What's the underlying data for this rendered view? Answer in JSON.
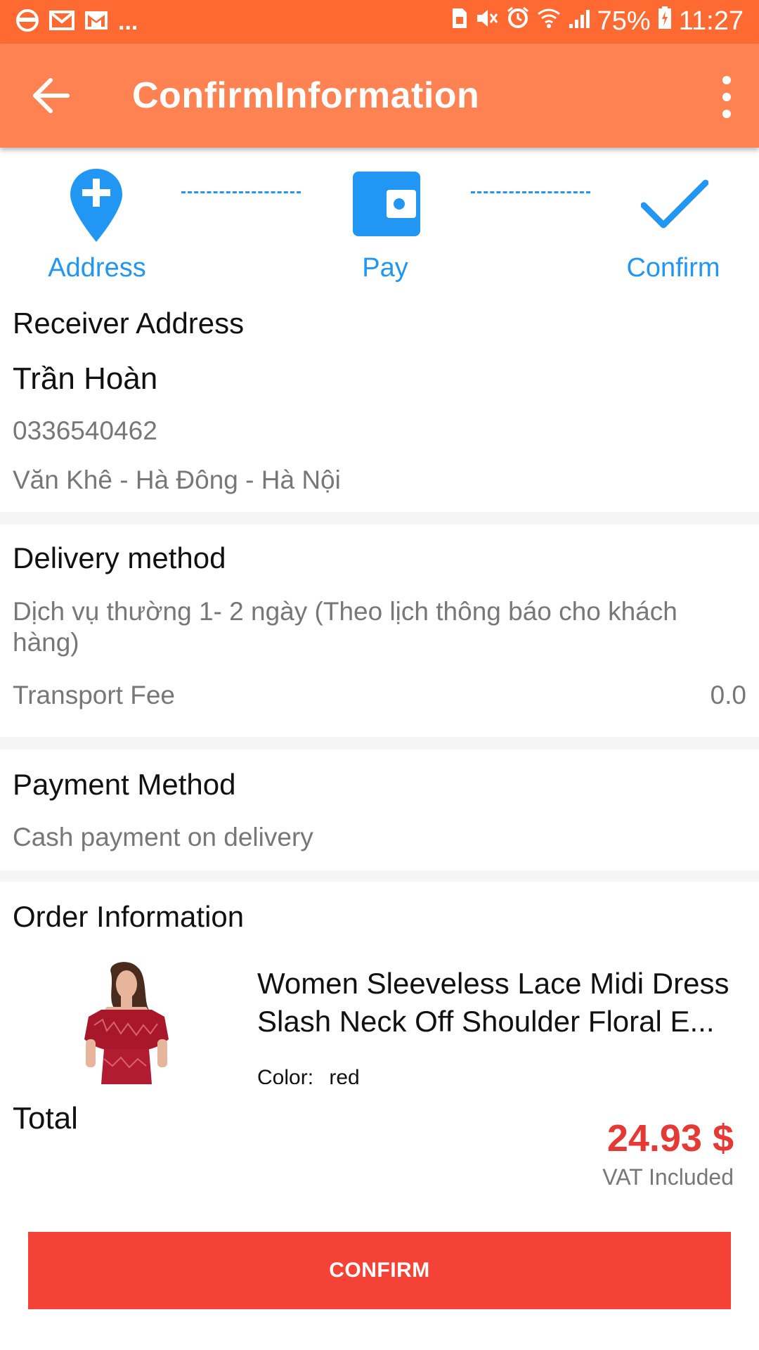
{
  "status_bar": {
    "battery": "75%",
    "time": "11:27",
    "more": "..."
  },
  "app_bar": {
    "title": "ConfirmInformation"
  },
  "steps": [
    {
      "label": "Address",
      "icon": "location-plus-icon"
    },
    {
      "label": "Pay",
      "icon": "wallet-icon"
    },
    {
      "label": "Confirm",
      "icon": "check-icon"
    }
  ],
  "receiver": {
    "heading": "Receiver Address",
    "name": "Trần Hoàn",
    "phone": "0336540462",
    "address": "Văn Khê - Hà Đông - Hà Nội"
  },
  "delivery": {
    "heading": "Delivery method",
    "method": "Dịch vụ thường 1- 2 ngày (Theo lịch thông báo cho khách hàng)",
    "fee_label": "Transport Fee",
    "fee_value": "0.0"
  },
  "payment": {
    "heading": "Payment Method",
    "method": "Cash payment on delivery"
  },
  "order": {
    "heading": "Order Information",
    "product_title": "Women Sleeveless Lace Midi Dress Slash Neck Off Shoulder Floral E...",
    "color_label": "Color:",
    "color_value": "red"
  },
  "total": {
    "label": "Total",
    "value": "24.93 $",
    "note": "VAT Included"
  },
  "confirm_button": "CONFIRM",
  "colors": {
    "status_bar": "#ff6a33",
    "app_bar": "#ff8352",
    "accent_blue": "#2196f3",
    "price_red": "#e53935",
    "button_red": "#f44336"
  }
}
